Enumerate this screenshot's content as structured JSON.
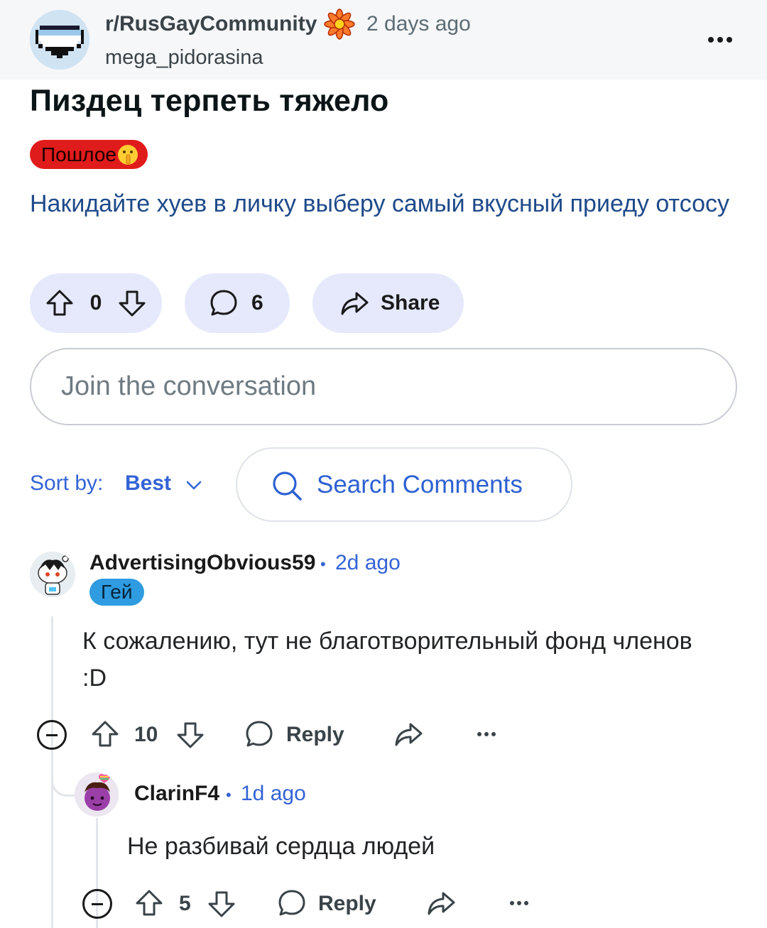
{
  "post": {
    "subreddit": "r/RusGayCommunity",
    "time": "2 days ago",
    "author": "mega_pidorasina",
    "title": "Пиздец терпеть тяжело",
    "flair": "Пошлое",
    "body": "Накидайте хуев в личку выберу самый вкусный приеду отсосу",
    "score": "0",
    "comments_count": "6",
    "share_label": "Share"
  },
  "composer": {
    "placeholder": "Join the conversation"
  },
  "sort": {
    "label": "Sort by:",
    "value": "Best",
    "search_label": "Search Comments"
  },
  "comments": [
    {
      "author": "AdvertisingObvious59",
      "time": "2d ago",
      "flair": "Гей",
      "body": "К сожалению, тут не благотворительный фонд членов :D",
      "score": "10",
      "reply_label": "Reply"
    },
    {
      "author": "ClarinF4",
      "time": "1d ago",
      "body": "Не разбивай сердца людей",
      "score": "5",
      "reply_label": "Reply"
    }
  ],
  "colors": {
    "accent": "#3463d6",
    "flair_red": "#e01b1b",
    "flair_blue": "#2f9be0",
    "pill_bg": "#e5e9fb"
  },
  "icons": [
    "heart-pixel-avatar",
    "flower-icon",
    "more-icon",
    "upvote-icon",
    "downvote-icon",
    "comment-icon",
    "share-icon",
    "chevron-down-icon",
    "search-icon",
    "collapse-icon"
  ]
}
